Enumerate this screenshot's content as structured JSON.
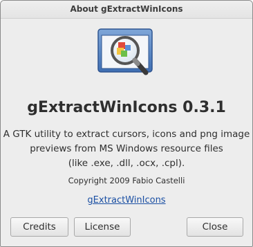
{
  "window": {
    "title": "About gExtractWinIcons"
  },
  "app": {
    "icon": "magnifier-window-icon",
    "name": "gExtractWinIcons 0.3.1",
    "description_lines": [
      "A GTK utility to extract cursors, icons and png image",
      "previews from MS Windows resource files",
      "(like .exe, .dll, .ocx, .cpl)."
    ],
    "copyright": "Copyright 2009 Fabio Castelli",
    "website_label": "gExtractWinIcons"
  },
  "buttons": {
    "credits": "Credits",
    "license": "License",
    "close": "Close"
  },
  "colors": {
    "background": "#ededed",
    "link": "#1a4fa3",
    "text": "#2e2e2e"
  }
}
